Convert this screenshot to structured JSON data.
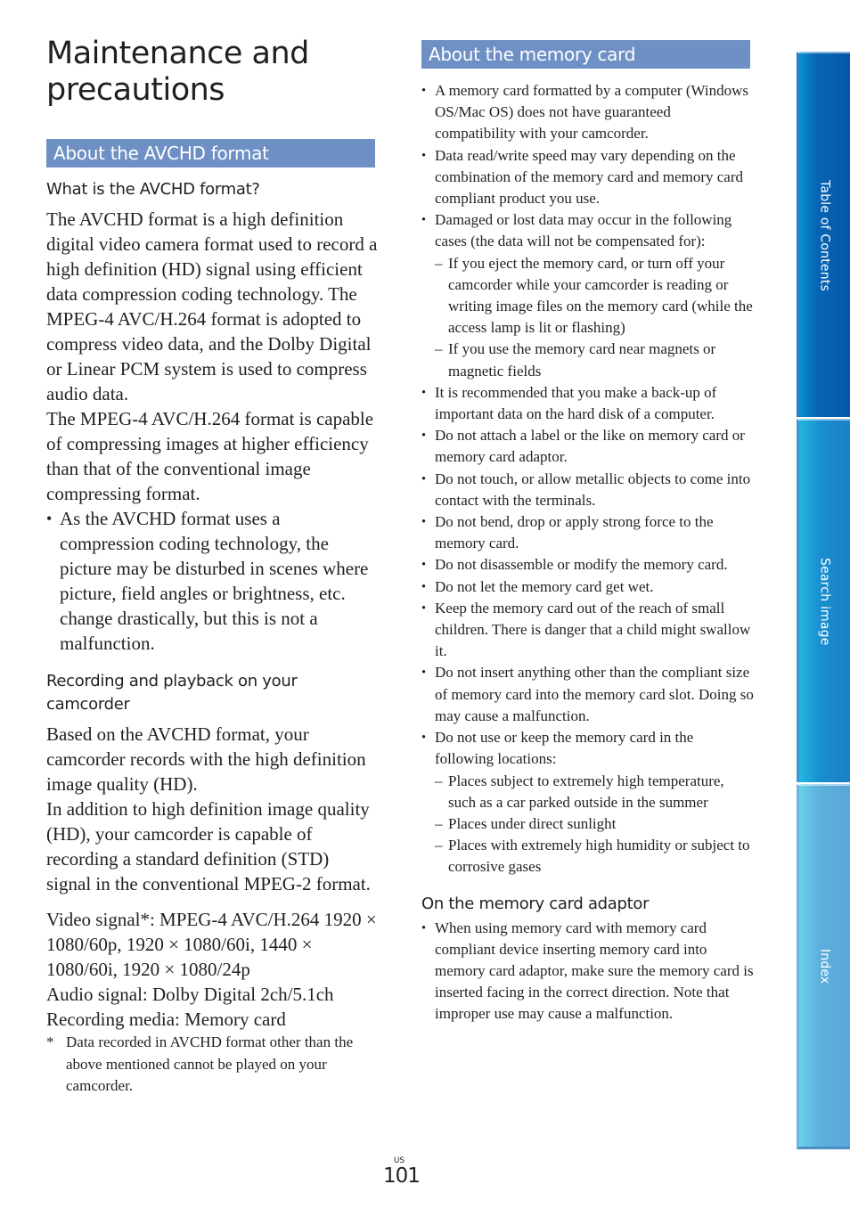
{
  "page": {
    "title": "Maintenance and precautions",
    "page_number": "101",
    "region_code": "US"
  },
  "side_tabs": [
    {
      "label": "Table of Contents"
    },
    {
      "label": "Search image"
    },
    {
      "label": "Index"
    }
  ],
  "avchd_section": {
    "heading": "About the AVCHD format",
    "what_is": {
      "subheading": "What is the AVCHD format?",
      "paragraphs": [
        "The AVCHD format is a high definition digital video camera format used to record a high definition (HD) signal using efficient data compression coding technology. The MPEG-4 AVC/H.264 format is adopted to compress video data, and the Dolby Digital or Linear PCM system is used to compress audio data.",
        "The MPEG-4 AVC/H.264 format is capable of compressing images at higher efficiency than that of the conventional image compressing format."
      ],
      "bullets": [
        "As the AVCHD format uses a compression coding technology, the picture may be disturbed in scenes where picture, field angles or brightness, etc. change drastically, but this is not a malfunction."
      ]
    },
    "recording": {
      "subheading": "Recording and playback on your camcorder",
      "paragraphs": [
        "Based on the AVCHD format, your camcorder records with the high definition image quality (HD).",
        "In addition to high definition image quality (HD), your camcorder is capable of recording a standard definition (STD) signal in the conventional MPEG-2 format."
      ],
      "specs": [
        "Video signal*: MPEG-4 AVC/H.264 1920 × 1080/60p, 1920 × 1080/60i, 1440 × 1080/60i, 1920 × 1080/24p",
        "Audio signal: Dolby Digital 2ch/5.1ch",
        "Recording media: Memory card"
      ],
      "footnote_mark": "*",
      "footnote": "Data recorded in AVCHD format other than the above mentioned cannot be played on your camcorder."
    }
  },
  "memory_section": {
    "heading": "About the memory card",
    "bullets": [
      {
        "text": "A memory card formatted by a computer (Windows OS/Mac OS) does not have guaranteed compatibility with your camcorder."
      },
      {
        "text": "Data read/write speed may vary depending on the combination of the memory card and memory card compliant product you use."
      },
      {
        "text": "Damaged or lost data may occur in the following cases (the data will not be compensated for):",
        "sub": [
          "If you eject the memory card, or turn off your camcorder while your camcorder is reading or writing image files on the memory card (while the access lamp is lit or flashing)",
          "If you use the memory card near magnets or magnetic fields"
        ]
      },
      {
        "text": "It is recommended that you make a back-up of important data on the hard disk of a computer."
      },
      {
        "text": "Do not attach a label or the like on memory card or memory card adaptor."
      },
      {
        "text": "Do not touch, or allow metallic objects to come into contact with the terminals."
      },
      {
        "text": "Do not bend, drop or apply strong force to the memory card."
      },
      {
        "text": "Do not disassemble or modify the memory card."
      },
      {
        "text": "Do not let the memory card get wet."
      },
      {
        "text": "Keep the memory card out of the reach of small children. There is danger that a child might swallow it."
      },
      {
        "text": "Do not insert anything other than the compliant size of memory card into the memory card slot. Doing so may cause a malfunction."
      },
      {
        "text": "Do not use or keep the memory card in the following locations:",
        "sub": [
          "Places subject to extremely high temperature, such as a car parked outside in the summer",
          "Places under direct sunlight",
          "Places with extremely high humidity or subject to corrosive gases"
        ]
      }
    ],
    "adaptor": {
      "subheading": "On the memory card adaptor",
      "bullets": [
        "When using memory card with memory card compliant device inserting memory card into memory card adaptor, make sure the memory card is inserted facing in the correct direction. Note that improper use may cause a malfunction."
      ]
    }
  },
  "colors": {
    "section_bar": "#6f90c5",
    "tab_toc": "#0556a8",
    "tab_search": "#1a8fcf",
    "tab_index": "#5cb0dc",
    "text": "#231f20"
  }
}
